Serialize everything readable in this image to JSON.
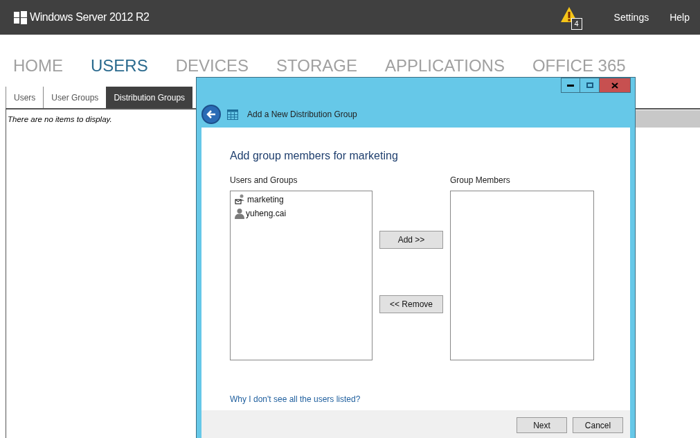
{
  "topbar": {
    "product": "Windows Server 2012 R2",
    "alert_count": "4",
    "links": [
      "Settings",
      "Help"
    ]
  },
  "nav": [
    {
      "label": "HOME",
      "selected": false
    },
    {
      "label": "USERS",
      "selected": true
    },
    {
      "label": "DEVICES",
      "selected": false
    },
    {
      "label": "STORAGE",
      "selected": false
    },
    {
      "label": "APPLICATIONS",
      "selected": false
    },
    {
      "label": "OFFICE 365",
      "selected": false
    }
  ],
  "subtabs": [
    {
      "label": "Users",
      "selected": false
    },
    {
      "label": "User Groups",
      "selected": false
    },
    {
      "label": "Distribution Groups",
      "selected": true
    }
  ],
  "empty_message": "There are no items to display.",
  "dialog": {
    "title": "Add a New Distribution Group",
    "heading": "Add group members for marketing",
    "source_label": "Users and Groups",
    "source_items": [
      {
        "kind": "group",
        "name": "marketing"
      },
      {
        "kind": "user",
        "name": "yuheng.cai"
      }
    ],
    "target_label": "Group Members",
    "add_button": "Add >>",
    "remove_button": "<< Remove",
    "help_link": "Why I don't see all the users listed?",
    "buttons": [
      "Next",
      "Cancel"
    ]
  }
}
